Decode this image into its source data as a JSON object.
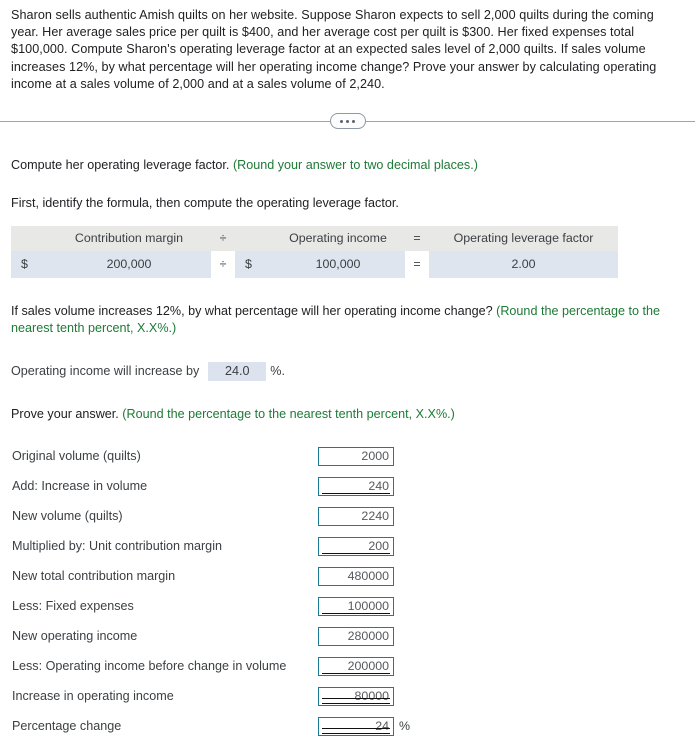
{
  "problem": {
    "text": "Sharon sells authentic Amish quilts on her website. Suppose Sharon expects to sell 2,000 quilts during the coming year. Her average sales price per quilt is $400, and her average cost per quilt is $300. Her fixed expenses total $100,000. Compute Sharon's operating leverage factor at an expected sales level of 2,000 quilts. If sales volume increases 12%, by what percentage will her operating income change? Prove your answer by calculating operating income at a sales volume of 2,000 and at a sales volume of 2,240."
  },
  "divider": {
    "dots_label": "more-options"
  },
  "part1": {
    "prompt": "Compute her operating leverage factor.",
    "hint": "(Round your answer to two decimal places.)",
    "subprompt": "First, identify the formula, then compute the operating leverage factor."
  },
  "formula_table": {
    "headers": {
      "blank": "",
      "col1": "Contribution margin",
      "op1": "÷",
      "col2": "Operating income",
      "op2": "=",
      "col3": "Operating leverage factor"
    },
    "values": {
      "currency1": "$",
      "val1": "200,000",
      "op1": "÷",
      "currency2": "$",
      "val2": "100,000",
      "op2": "=",
      "result": "2.00"
    }
  },
  "part2": {
    "prompt": "If sales volume increases 12%, by what percentage will her operating income change?",
    "hint": "(Round the percentage to the nearest tenth percent, X.X%.)",
    "answer_prefix": "Operating income will increase by",
    "answer_value": "24.0",
    "answer_suffix": "%."
  },
  "part3": {
    "prompt": "Prove your answer.",
    "hint": "(Round the percentage to the nearest tenth percent, X.X%.)",
    "rows": [
      {
        "label": "Original volume (quilts)",
        "value": "2000",
        "rule": "none",
        "suffix": ""
      },
      {
        "label": "Add: Increase in volume",
        "value": "240",
        "rule": "single",
        "suffix": ""
      },
      {
        "label": "New volume (quilts)",
        "value": "2240",
        "rule": "none",
        "suffix": ""
      },
      {
        "label": "Multiplied by: Unit contribution margin",
        "value": "200",
        "rule": "single",
        "suffix": ""
      },
      {
        "label": "New total contribution margin",
        "value": "480000",
        "rule": "none",
        "suffix": ""
      },
      {
        "label": "Less: Fixed expenses",
        "value": "100000",
        "rule": "single",
        "suffix": ""
      },
      {
        "label": "New operating income",
        "value": "280000",
        "rule": "none",
        "suffix": ""
      },
      {
        "label": "Less: Operating income before change in volume",
        "value": "200000",
        "rule": "single",
        "suffix": ""
      },
      {
        "label": "Increase in operating income",
        "value": "80000",
        "rule": "double",
        "suffix": ""
      },
      {
        "label": "Percentage change",
        "value": "24",
        "rule": "double",
        "suffix": "%"
      }
    ]
  },
  "colors": {
    "hint_green": "#1e7a37",
    "field_border": "#1c7a94",
    "table_header_bg": "#e8e8e6",
    "table_value_bg": "#dee5ef",
    "chip_bg": "#dce3ee"
  }
}
